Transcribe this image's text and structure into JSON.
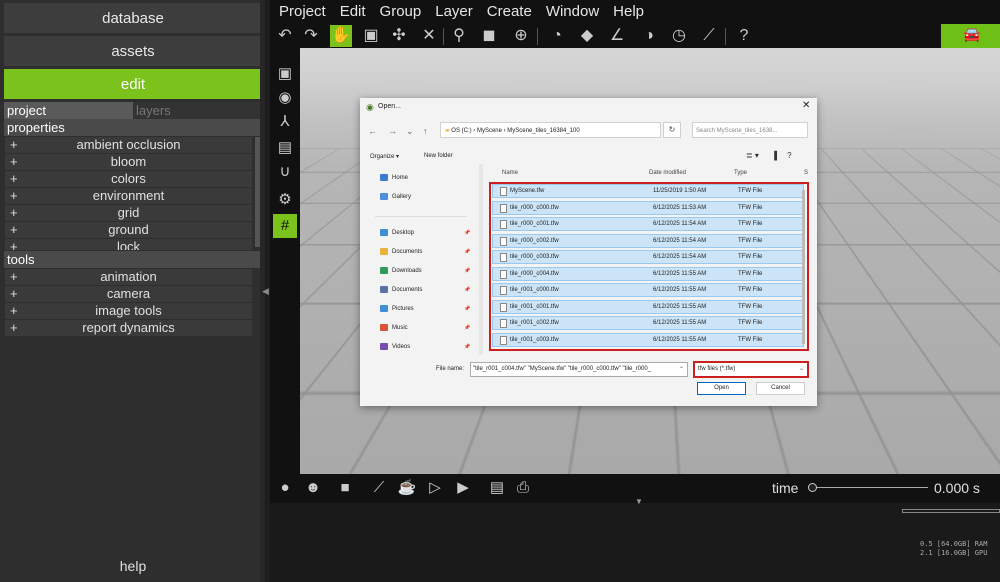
{
  "left_panel": {
    "database": "database",
    "assets": "assets",
    "edit": "edit",
    "tabs": [
      "project",
      "layers"
    ],
    "properties_title": "properties",
    "properties": [
      "ambient occlusion",
      "bloom",
      "colors",
      "environment",
      "grid",
      "ground",
      "lock"
    ],
    "tools_title": "tools",
    "tools": [
      "animation",
      "camera",
      "image tools",
      "report dynamics"
    ],
    "help": "help",
    "plus": "+"
  },
  "menubar": [
    "Project",
    "Edit",
    "Group",
    "Layer",
    "Create",
    "Window",
    "Help"
  ],
  "timeline": {
    "label": "time",
    "value": "0.000 s"
  },
  "status": {
    "ram": "0.5 [64.0GB] RAM\n2.1 [16.0GB] GPU"
  },
  "dialog": {
    "title": "Open...",
    "address": "OS (C:) › MyScene › MyScene_tiles_16384_100",
    "search_placeholder": "Search MyScene_tiles_1638...",
    "organize": "Organize ▾",
    "new_folder": "New folder",
    "nav": [
      {
        "label": "Home",
        "color": "#3a7bd5",
        "pin": false
      },
      {
        "label": "Gallery",
        "color": "#4f8fe0",
        "pin": false
      },
      {
        "label": "Desktop",
        "color": "#3d8ed6",
        "pin": true
      },
      {
        "label": "Documents",
        "color": "#e8b33c",
        "pin": true
      },
      {
        "label": "Downloads",
        "color": "#2f9a5a",
        "pin": true
      },
      {
        "label": "Documents",
        "color": "#5b6fa8",
        "pin": true
      },
      {
        "label": "Pictures",
        "color": "#3e8fd8",
        "pin": true
      },
      {
        "label": "Music",
        "color": "#d6553c",
        "pin": true
      },
      {
        "label": "Videos",
        "color": "#7a4bb0",
        "pin": true
      }
    ],
    "pin_glyph": "📌",
    "columns": {
      "name": "Name",
      "date": "Date modified",
      "type": "Type",
      "size": "S"
    },
    "files": [
      {
        "name": "MyScene.tfw",
        "date": "11/25/2019 1:50 AM",
        "type": "TFW File"
      },
      {
        "name": "tile_r000_c000.tfw",
        "date": "6/12/2025 11:53 AM",
        "type": "TFW File"
      },
      {
        "name": "tile_r000_c001.tfw",
        "date": "6/12/2025 11:54 AM",
        "type": "TFW File"
      },
      {
        "name": "tile_r000_c002.tfw",
        "date": "6/12/2025 11:54 AM",
        "type": "TFW File"
      },
      {
        "name": "tile_r000_c003.tfw",
        "date": "6/12/2025 11:54 AM",
        "type": "TFW File"
      },
      {
        "name": "tile_r000_c004.tfw",
        "date": "6/12/2025 11:55 AM",
        "type": "TFW File"
      },
      {
        "name": "tile_r001_c000.tfw",
        "date": "6/12/2025 11:55 AM",
        "type": "TFW File"
      },
      {
        "name": "tile_r001_c001.tfw",
        "date": "6/12/2025 11:55 AM",
        "type": "TFW File"
      },
      {
        "name": "tile_r001_c002.tfw",
        "date": "6/12/2025 11:55 AM",
        "type": "TFW File"
      },
      {
        "name": "tile_r001_c003.tfw",
        "date": "6/12/2025 11:55 AM",
        "type": "TFW File"
      }
    ],
    "file_name_label": "File name:",
    "file_name_value": "\"tile_r001_c004.tfw\" \"MyScene.tfw\" \"tile_r000_c000.tfw\" \"tile_r000_",
    "file_type": "tfw files (*.tfw)",
    "open": "Open",
    "cancel": "Cancel"
  },
  "colors": {
    "accent": "#7cc21c",
    "selection_outline": "#cc1f1f"
  }
}
